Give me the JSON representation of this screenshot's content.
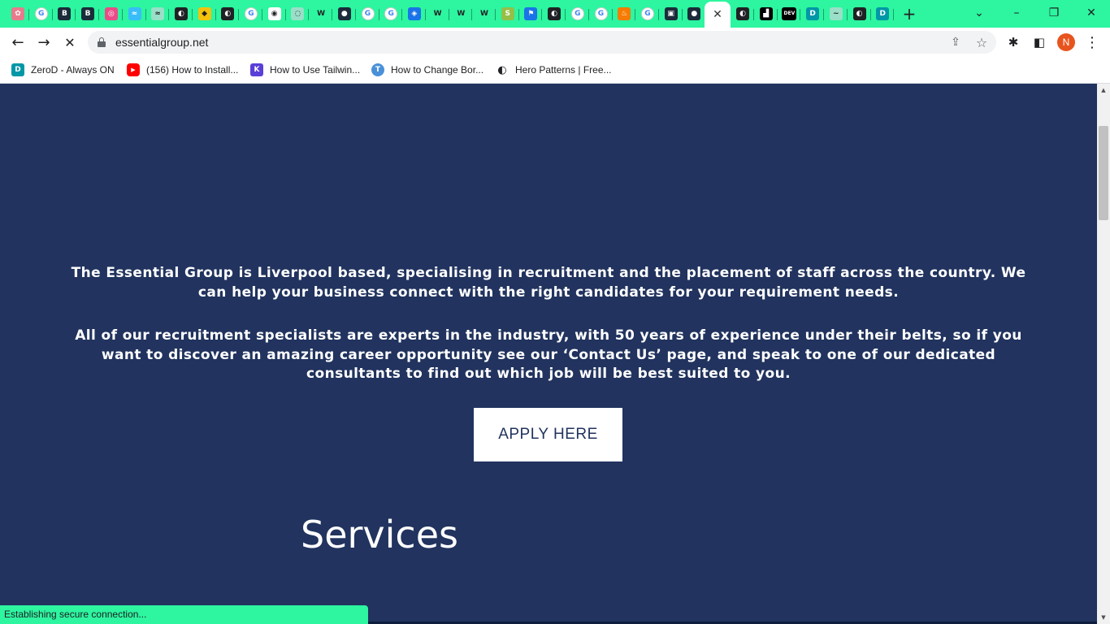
{
  "browser": {
    "tabs": [
      {
        "icon": "flower-icon",
        "color": "#e77b8c",
        "glyph": "✿"
      },
      {
        "icon": "google-icon",
        "color": "#ffffff",
        "glyph": "G"
      },
      {
        "icon": "document-icon",
        "color": "#1b2b3a",
        "glyph": "B"
      },
      {
        "icon": "document-icon",
        "color": "#1b2b3a",
        "glyph": "B"
      },
      {
        "icon": "dribbble-icon",
        "color": "#ea4c89",
        "glyph": "◎"
      },
      {
        "icon": "tailwind-icon",
        "color": "#38bdf8",
        "glyph": "≈"
      },
      {
        "icon": "tailwind-icon",
        "color": "#9adfc8",
        "glyph": "≈"
      },
      {
        "icon": "globe-icon",
        "color": "#202124",
        "glyph": "◐"
      },
      {
        "icon": "shield-icon",
        "color": "#f4c20d",
        "glyph": "◆"
      },
      {
        "icon": "globe-icon",
        "color": "#202124",
        "glyph": "◐"
      },
      {
        "icon": "google-icon",
        "color": "#ffffff",
        "glyph": "G"
      },
      {
        "icon": "chrome-icon",
        "color": "#ffffff",
        "glyph": "◉"
      },
      {
        "icon": "loading-icon",
        "color": "#9adfc8",
        "glyph": "◌"
      },
      {
        "icon": "webflow-icon",
        "color": "#2df5a0",
        "glyph": "W"
      },
      {
        "icon": "circle-icon",
        "color": "#1b2b3a",
        "glyph": "●"
      },
      {
        "icon": "google-icon",
        "color": "#ffffff",
        "glyph": "G"
      },
      {
        "icon": "google-icon",
        "color": "#ffffff",
        "glyph": "G"
      },
      {
        "icon": "app-icon",
        "color": "#1a73e8",
        "glyph": "◈"
      },
      {
        "icon": "webflow-icon",
        "color": "#2df5a0",
        "glyph": "W"
      },
      {
        "icon": "webflow-icon",
        "color": "#2df5a0",
        "glyph": "W"
      },
      {
        "icon": "webflow-icon",
        "color": "#2df5a0",
        "glyph": "W"
      },
      {
        "icon": "shopify-icon",
        "color": "#95bf47",
        "glyph": "S"
      },
      {
        "icon": "flag-icon",
        "color": "#1a73e8",
        "glyph": "⚑"
      },
      {
        "icon": "globe-icon",
        "color": "#202124",
        "glyph": "◐"
      },
      {
        "icon": "google-icon",
        "color": "#ffffff",
        "glyph": "G"
      },
      {
        "icon": "google-icon",
        "color": "#ffffff",
        "glyph": "G"
      },
      {
        "icon": "fire-icon",
        "color": "#f57c00",
        "glyph": "♨"
      },
      {
        "icon": "google-icon",
        "color": "#ffffff",
        "glyph": "G"
      },
      {
        "icon": "image-icon",
        "color": "#1b2b3a",
        "glyph": "▣"
      },
      {
        "icon": "circle-icon",
        "color": "#1b2b3a",
        "glyph": "●"
      },
      {
        "icon": "close-icon",
        "color": "#ffffff",
        "glyph": "✕",
        "active": true
      },
      {
        "icon": "globe-icon",
        "color": "#202124",
        "glyph": "◐"
      },
      {
        "icon": "grid-icon",
        "color": "#000000",
        "glyph": "▟"
      },
      {
        "icon": "dev-icon",
        "color": "#000000",
        "glyph": "DEV"
      },
      {
        "icon": "zerod-icon",
        "color": "#0097a7",
        "glyph": "D"
      },
      {
        "icon": "wave-icon",
        "color": "#9adfc8",
        "glyph": "~"
      },
      {
        "icon": "globe-icon",
        "color": "#202124",
        "glyph": "◐"
      },
      {
        "icon": "zerod-icon",
        "color": "#0097a7",
        "glyph": "D"
      }
    ],
    "new_tab_glyph": "+",
    "window_controls": {
      "chevron": "⌄",
      "minimize": "–",
      "restore": "❐",
      "close": "✕"
    },
    "nav": {
      "back": "←",
      "forward": "→",
      "stop": "✕"
    },
    "url": "essentialgroup.net",
    "omnibox_icons": {
      "share": "⇪",
      "star": "☆"
    },
    "toolbar_icons": {
      "extensions": "✱",
      "sidepanel": "◧",
      "menu": "⋮"
    },
    "avatar_initial": "N",
    "accent_color": "#2df5a0",
    "bookmarks": [
      {
        "label": "ZeroD - Always ON",
        "icon": "zerod-icon",
        "color": "#0097a7",
        "glyph": "D"
      },
      {
        "label": "(156) How to Install...",
        "icon": "youtube-icon",
        "color": "#ff0000",
        "glyph": "▶"
      },
      {
        "label": "How to Use Tailwin...",
        "icon": "k-icon",
        "color": "#5a3fd8",
        "glyph": "K"
      },
      {
        "label": "How to Change Bor...",
        "icon": "tutorial-icon",
        "color": "#4a90d9",
        "glyph": "T"
      },
      {
        "label": "Hero Patterns | Free...",
        "icon": "globe-icon",
        "color": "#202124",
        "glyph": "◐"
      }
    ],
    "status_text": "Establishing secure connection..."
  },
  "page": {
    "background": "#21335e",
    "intro_paragraph": "The Essential Group is Liverpool based, specialising in recruitment and the placement of staff across the country. We can help your business connect with the right candidates for your requirement needs.",
    "detail_paragraph": "All of our recruitment specialists are experts in the industry, with 50 years of experience under their belts, so if you want to discover an amazing career opportunity see our ‘Contact Us’ page, and speak to one of our dedicated consultants to find out which job will be best suited to you.",
    "apply_button": "APPLY HERE",
    "services_heading": "Services"
  }
}
